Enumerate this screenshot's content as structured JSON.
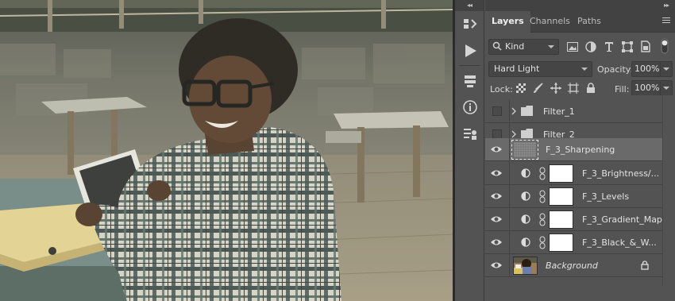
{
  "colors": {
    "panel_bg": "#535353",
    "tab_bar_bg": "#424242",
    "selected_layer_bg": "#6a6a6a",
    "text": "#e2e2e2"
  },
  "tools": {
    "collapse_label": "◂◂",
    "icons": [
      "history-icon",
      "play-actions-icon",
      "libraries-icon",
      "info-icon",
      "properties-icon"
    ]
  },
  "panel": {
    "collapse_label": "▸▸",
    "tabs": [
      {
        "label": "Layers",
        "active": true
      },
      {
        "label": "Channels",
        "active": false
      },
      {
        "label": "Paths",
        "active": false
      }
    ],
    "filter": {
      "kind_label": "Kind"
    },
    "blend": {
      "mode": "Hard Light",
      "opacity_label": "Opacity:",
      "opacity_value": "100%"
    },
    "lock": {
      "lock_label": "Lock:",
      "fill_label": "Fill:",
      "fill_value": "100%"
    },
    "layers": [
      {
        "name": "Filter_1",
        "type": "group",
        "visible": false,
        "selected": false
      },
      {
        "name": "Filter_2",
        "type": "group",
        "visible": false,
        "selected": false
      },
      {
        "name": "F_3_Sharpening",
        "type": "smart",
        "visible": true,
        "selected": true
      },
      {
        "name": "F_3_Brightness/...",
        "type": "adjustment",
        "visible": true,
        "selected": false
      },
      {
        "name": "F_3_Levels",
        "type": "adjustment",
        "visible": true,
        "selected": false
      },
      {
        "name": "F_3_Gradient_Map",
        "type": "adjustment",
        "visible": true,
        "selected": false
      },
      {
        "name": "F_3_Black_&_W...",
        "type": "adjustment",
        "visible": true,
        "selected": false
      },
      {
        "name": "Background",
        "type": "background",
        "visible": true,
        "selected": false,
        "locked": true
      }
    ]
  }
}
